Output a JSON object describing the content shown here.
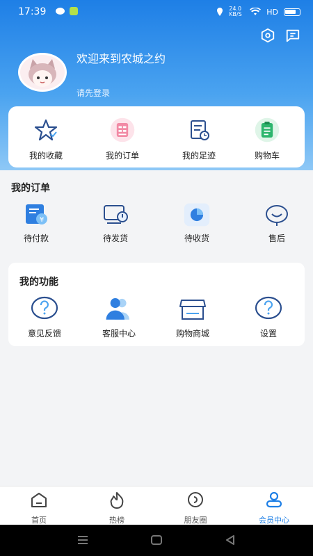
{
  "status_bar": {
    "time": "17:39",
    "network": "24.0 KB/S",
    "signal": "HD",
    "battery": "71"
  },
  "header": {
    "welcome": "欢迎来到农城之约",
    "login_prompt": "请先登录",
    "icons": [
      "settings-hex-icon",
      "message-icon"
    ]
  },
  "quick_links": [
    {
      "label": "我的收藏",
      "icon": "star-icon"
    },
    {
      "label": "我的订单",
      "icon": "order-list-icon"
    },
    {
      "label": "我的足迹",
      "icon": "footprint-icon"
    },
    {
      "label": "购物车",
      "icon": "clipboard-icon"
    }
  ],
  "orders": {
    "title": "我的订单",
    "items": [
      {
        "label": "待付款",
        "icon": "payment-icon"
      },
      {
        "label": "待发货",
        "icon": "shipping-icon"
      },
      {
        "label": "待收货",
        "icon": "receive-icon"
      },
      {
        "label": "售后",
        "icon": "after-sale-icon"
      }
    ]
  },
  "functions": {
    "title": "我的功能",
    "items": [
      {
        "label": "意见反馈",
        "icon": "question-icon"
      },
      {
        "label": "客服中心",
        "icon": "customer-service-icon"
      },
      {
        "label": "购物商城",
        "icon": "shop-icon"
      },
      {
        "label": "设置",
        "icon": "question-icon"
      }
    ]
  },
  "bottom_nav": [
    {
      "label": "首页",
      "icon": "home-icon",
      "active": false
    },
    {
      "label": "热榜",
      "icon": "fire-icon",
      "active": false
    },
    {
      "label": "朋友圈",
      "icon": "moments-icon",
      "active": false
    },
    {
      "label": "会员中心",
      "icon": "member-icon",
      "active": true
    }
  ],
  "colors": {
    "primary": "#1e7fe6",
    "header_gradient_top": "#1e7fe6",
    "header_gradient_bottom": "#8ec8f6",
    "background": "#f3f4f6"
  }
}
